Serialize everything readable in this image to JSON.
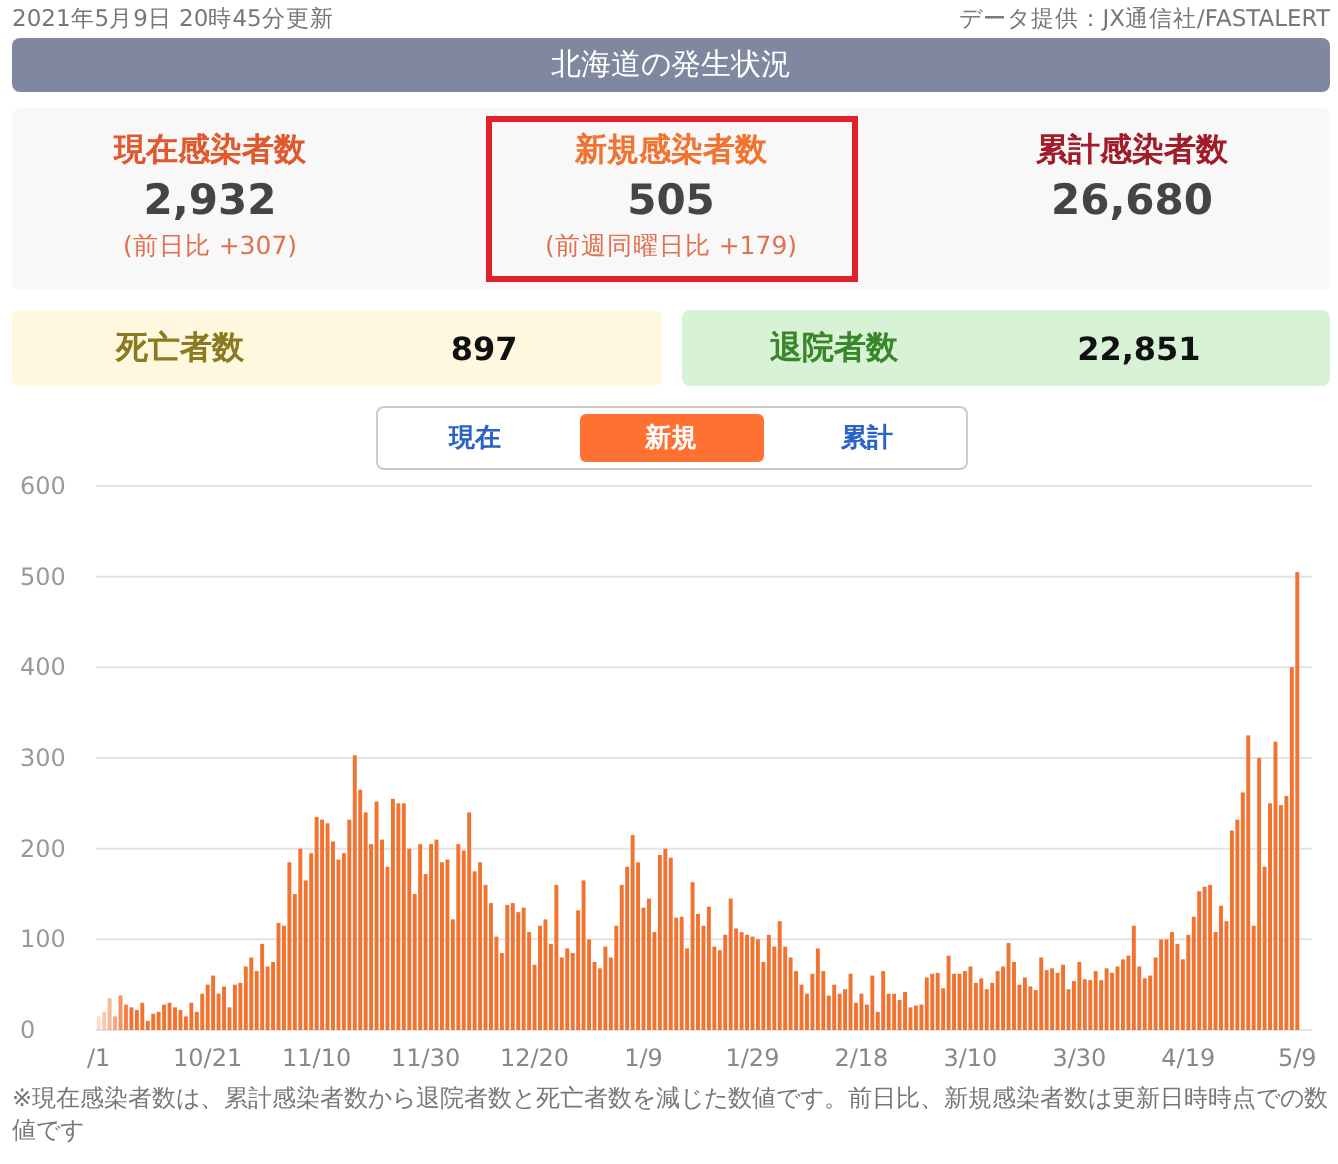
{
  "header": {
    "updated": "2021年5月9日 20時45分更新",
    "source": "データ提供：JX通信社/FASTALERT"
  },
  "title": "北海道の発生状況",
  "stats": [
    {
      "label": "現在感染者数",
      "value": "2,932",
      "change": "(前日比 +307)",
      "highlighted": false,
      "color": "#e0582c"
    },
    {
      "label": "新規感染者数",
      "value": "505",
      "change": "(前週同曜日比 +179)",
      "highlighted": true,
      "color": "#f27230"
    },
    {
      "label": "累計感染者数",
      "value": "26,680",
      "highlighted": false,
      "color": "#a01c28"
    }
  ],
  "outcomes": [
    {
      "label": "死亡者数",
      "value": "897",
      "kind": "death"
    },
    {
      "label": "退院者数",
      "value": "22,851",
      "kind": "discharged"
    }
  ],
  "tabs": [
    {
      "label": "現在",
      "selected": false
    },
    {
      "label": "新規",
      "selected": true
    },
    {
      "label": "累計",
      "selected": false
    }
  ],
  "chart": {
    "chart_data": {
      "type": "bar",
      "ylim": [
        0,
        600
      ],
      "yticks": [
        0,
        100,
        200,
        300,
        400,
        500,
        600
      ],
      "categories": [
        "/1",
        null,
        null,
        null,
        null,
        null,
        null,
        null,
        null,
        null,
        null,
        null,
        null,
        null,
        null,
        null,
        null,
        null,
        null,
        null,
        "10/21",
        null,
        null,
        null,
        null,
        null,
        null,
        null,
        null,
        null,
        null,
        null,
        null,
        null,
        null,
        null,
        null,
        null,
        null,
        null,
        "11/10",
        null,
        null,
        null,
        null,
        null,
        null,
        null,
        null,
        null,
        null,
        null,
        null,
        null,
        null,
        null,
        null,
        null,
        null,
        null,
        "11/30",
        null,
        null,
        null,
        null,
        null,
        null,
        null,
        null,
        null,
        null,
        null,
        null,
        null,
        null,
        null,
        null,
        null,
        null,
        null,
        "12/20",
        null,
        null,
        null,
        null,
        null,
        null,
        null,
        null,
        null,
        null,
        null,
        null,
        null,
        null,
        null,
        null,
        null,
        null,
        null,
        "1/9",
        null,
        null,
        null,
        null,
        null,
        null,
        null,
        null,
        null,
        null,
        null,
        null,
        null,
        null,
        null,
        null,
        null,
        null,
        null,
        "1/29",
        null,
        null,
        null,
        null,
        null,
        null,
        null,
        null,
        null,
        null,
        null,
        null,
        null,
        null,
        null,
        null,
        null,
        null,
        null,
        "2/18",
        null,
        null,
        null,
        null,
        null,
        null,
        null,
        null,
        null,
        null,
        null,
        null,
        null,
        null,
        null,
        null,
        null,
        null,
        null,
        "3/10",
        null,
        null,
        null,
        null,
        null,
        null,
        null,
        null,
        null,
        null,
        null,
        null,
        null,
        null,
        null,
        null,
        null,
        null,
        null,
        "3/30",
        null,
        null,
        null,
        null,
        null,
        null,
        null,
        null,
        null,
        null,
        null,
        null,
        null,
        null,
        null,
        null,
        null,
        null,
        null,
        "4/19",
        null,
        null,
        null,
        null,
        null,
        null,
        null,
        null,
        null,
        null,
        null,
        null,
        null,
        null,
        null,
        null,
        null,
        null,
        null,
        "5/9"
      ],
      "grid": true,
      "series": [
        {
          "color": "#f27230",
          "values": [
            15,
            20,
            35,
            15,
            38,
            28,
            25,
            22,
            30,
            10,
            18,
            20,
            28,
            30,
            25,
            22,
            15,
            30,
            20,
            40,
            50,
            60,
            40,
            48,
            25,
            50,
            52,
            70,
            80,
            65,
            95,
            70,
            75,
            118,
            115,
            185,
            150,
            200,
            165,
            195,
            235,
            232,
            228,
            208,
            188,
            195,
            232,
            303,
            265,
            240,
            205,
            252,
            210,
            180,
            255,
            250,
            250,
            200,
            150,
            205,
            172,
            205,
            210,
            185,
            188,
            122,
            205,
            198,
            240,
            175,
            185,
            160,
            140,
            103,
            85,
            138,
            140,
            130,
            135,
            108,
            72,
            115,
            122,
            95,
            160,
            80,
            90,
            85,
            132,
            165,
            100,
            75,
            68,
            92,
            80,
            115,
            160,
            180,
            215,
            185,
            135,
            145,
            108,
            193,
            200,
            190,
            124,
            125,
            90,
            163,
            128,
            115,
            136,
            92,
            88,
            105,
            145,
            112,
            108,
            105,
            103,
            100,
            75,
            105,
            92,
            120,
            92,
            80,
            65,
            50,
            40,
            62,
            90,
            65,
            38,
            50,
            40,
            45,
            62,
            30,
            40,
            28,
            60,
            20,
            65,
            40,
            40,
            33,
            42,
            25,
            27,
            28,
            58,
            62,
            63,
            46,
            82,
            62,
            62,
            65,
            70,
            52,
            57,
            45,
            52,
            65,
            70,
            96,
            75,
            50,
            58,
            48,
            44,
            80,
            66,
            68,
            63,
            72,
            45,
            54,
            75,
            56,
            55,
            65,
            55,
            68,
            63,
            70,
            78,
            82,
            115,
            70,
            57,
            60,
            80,
            100,
            100,
            108,
            95,
            78,
            105,
            125,
            153,
            158,
            160,
            108,
            137,
            120,
            220,
            232,
            262,
            325,
            115,
            300,
            180,
            250,
            318,
            248,
            258,
            400,
            505
          ]
        }
      ]
    }
  },
  "footnote": "※現在感染者数は、累計感染者数から退院者数と死亡者数を減じた数値です。前日比、新規感染者数は更新日時時点での数値です"
}
